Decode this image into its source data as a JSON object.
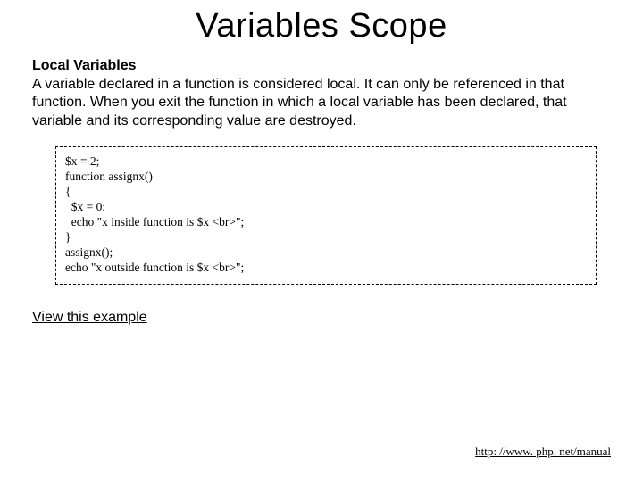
{
  "title": "Variables Scope",
  "subhead": "Local Variables",
  "body": "A variable declared in a function is considered local.\nIt can only be referenced in that function.\nWhen you exit the function in which a local variable has been declared, that variable and its corresponding value are destroyed.",
  "code": "$x = 2;\nfunction assignx()\n{\n  $x = 0;\n  echo \"x inside function is $x <br>\";\n}\nassignx();\necho \"x outside function is $x <br>\";",
  "example_link": "View this example",
  "footer_link": "http: //www. php. net/manual"
}
